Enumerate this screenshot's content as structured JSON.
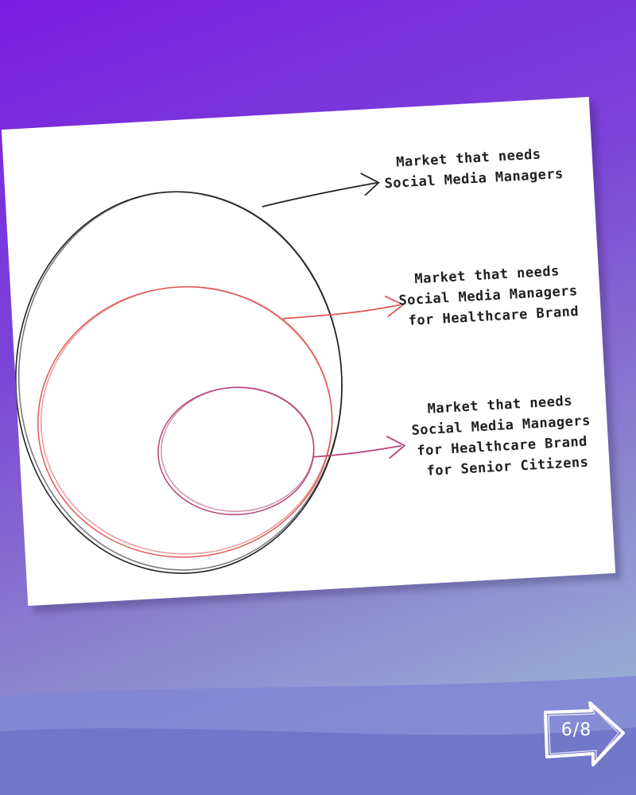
{
  "diagram": {
    "labels": {
      "market": [
        "Market that needs",
        "Social Media Managers"
      ],
      "healthcare": [
        "Market that needs",
        "Social Media Managers",
        "for Healthcare Brand"
      ],
      "senior": [
        "Market that needs",
        "Social Media Managers",
        "for Healthcare Brand",
        "for Senior Citizens"
      ]
    },
    "colors": {
      "outer": "#222222",
      "middle": "#e05858",
      "inner": "#b5447a"
    }
  },
  "nav": {
    "page_indicator": "6/8"
  }
}
